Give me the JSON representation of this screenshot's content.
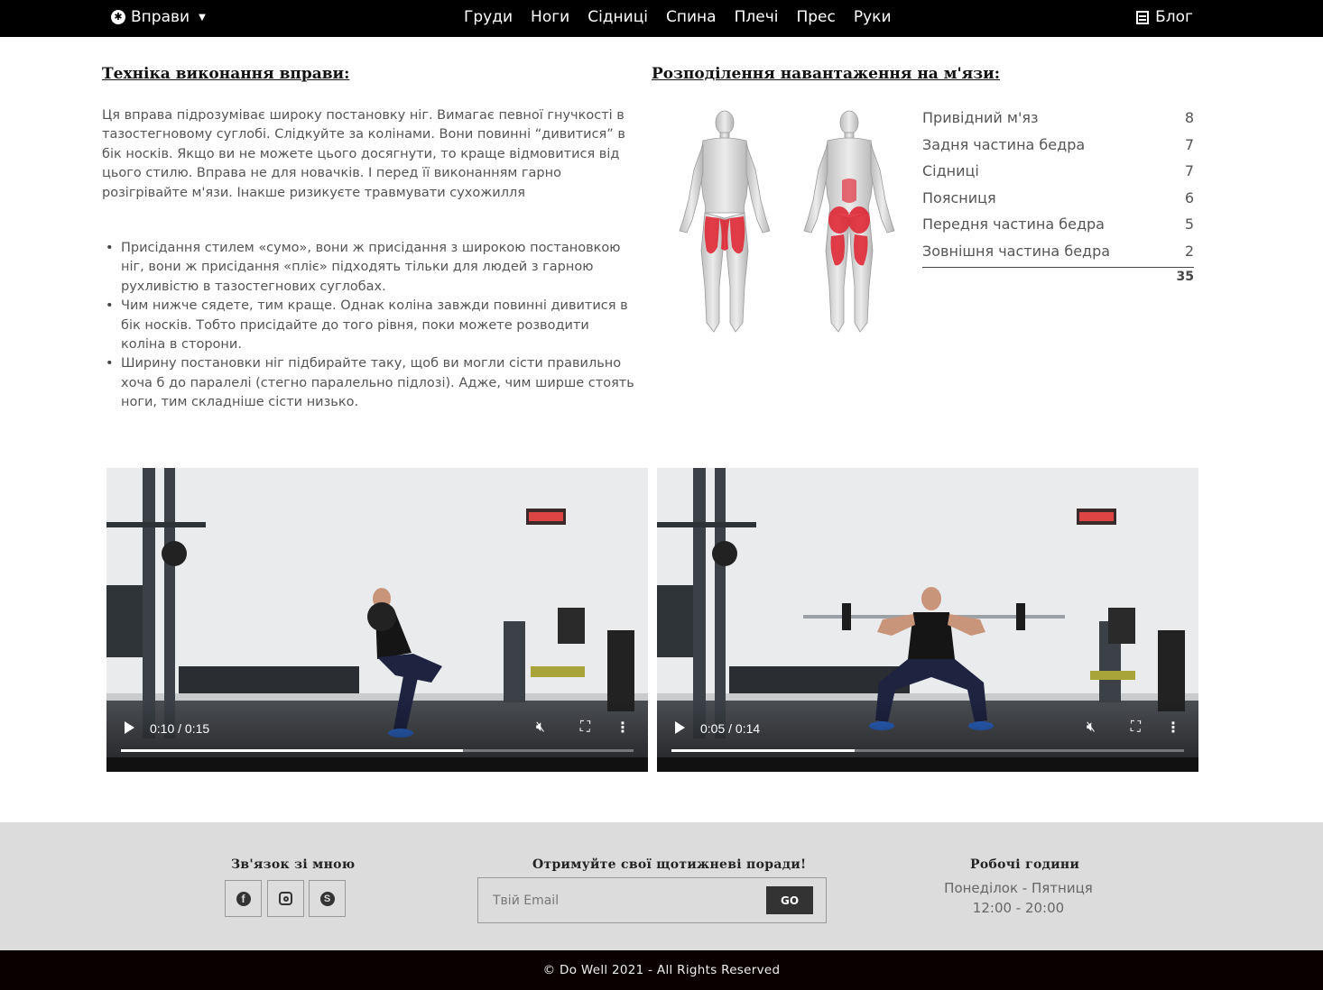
{
  "navbar": {
    "brand_label": "Вправи",
    "links": [
      "Груди",
      "Ноги",
      "Сідниці",
      "Спина",
      "Плечі",
      "Прес",
      "Руки"
    ],
    "blog_label": "Блог"
  },
  "technique": {
    "title": "Техніка виконання вправи:",
    "description": "Ця вправа підрозуміває широку постановку ніг. Вимагає певної гнучкості в тазостегновому суглобі. Слідкуйте за колінами. Вони повинні “дивитися” в бік носків. Якщо ви не можете цього досягнути, то краще відмовитися від цього стилю. Вправа не для новачків. І перед її виконанням гарно розігрівайте м'язи. Інакше ризикуєте травмувати сухожилля",
    "tips": [
      "Присідання стилем «сумо», вони ж присідання з широкою постановкою ніг, вони ж присідання «пліє» підходять тільки для людей з гарною рухливістю в тазостегнових суглобах.",
      "Чим нижче сядете, тим краще. Однак коліна завжди повинні дивитися в бік носків. Тобто присідайте до того рівня, поки можете розводити коліна в сторони.",
      "Ширину постановки ніг підбирайте таку, щоб ви могли сісти правильно хоча б до паралелі (стегно паралельно підлозі). Адже, чим ширше стоять ноги, тим складніше сісти низько."
    ]
  },
  "distribution": {
    "title": "Розподілення навантаження на м'язи:",
    "rows": [
      {
        "name": "Привідний м'яз",
        "value": "8"
      },
      {
        "name": "Задня частина бедра",
        "value": "7"
      },
      {
        "name": "Сідниці",
        "value": "7"
      },
      {
        "name": "Поясниця",
        "value": "6"
      },
      {
        "name": "Передня частина бедра",
        "value": "5"
      },
      {
        "name": "Зовнішня частина бедра",
        "value": "2"
      }
    ],
    "total": "35",
    "highlight_color": "#e01f2d"
  },
  "videos": [
    {
      "time": "0:10 / 0:15",
      "progress": 0.667
    },
    {
      "time": "0:05 / 0:14",
      "progress": 0.357
    }
  ],
  "footer": {
    "contact_title": "Зв'язок зі мною",
    "newsletter_title": "Отримуйте свої щотижневі поради!",
    "email_placeholder": "Твій Email",
    "go_label": "GO",
    "hours_title": "Робочі години",
    "hours_days": "Понеділок - Пятниця",
    "hours_time": "12:00 - 20:00",
    "copyright": "© Do Well 2021 - All Rights Reserved"
  },
  "icons": {
    "brand": "accessibility-icon",
    "blog": "list-icon",
    "social": [
      "facebook-icon",
      "instagram-icon",
      "skype-icon"
    ]
  }
}
